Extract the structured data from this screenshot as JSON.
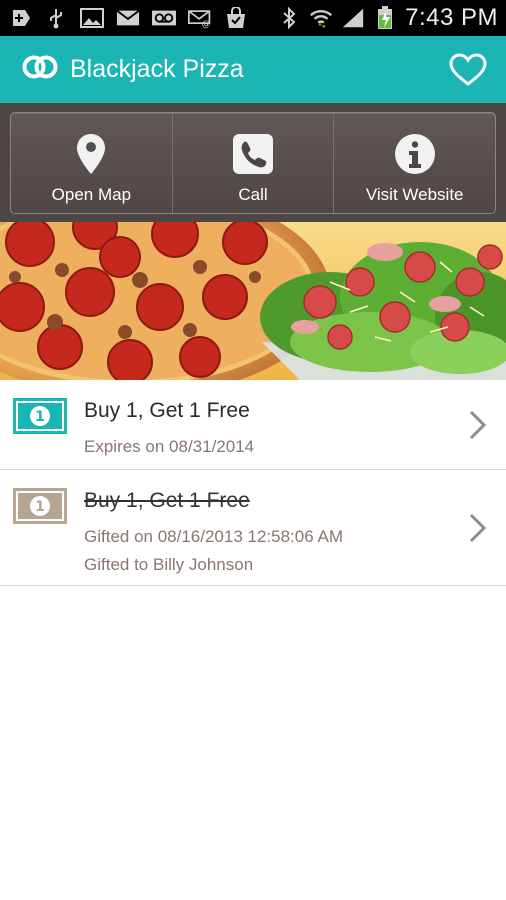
{
  "status_bar": {
    "time": "7:43 PM",
    "icons": [
      "add-icon",
      "usb-icon",
      "image-icon",
      "gmail-icon",
      "voicemail-icon",
      "missed-email-icon",
      "store-bag-icon",
      "bluetooth-icon",
      "wifi-icon",
      "signal-icon",
      "battery-charging-icon"
    ]
  },
  "header": {
    "title": "Blackjack Pizza",
    "logo": "rings-logo-icon",
    "favorite_icon": "heart-icon"
  },
  "actions": [
    {
      "label": "Open Map",
      "icon": "map-pin-icon"
    },
    {
      "label": "Call",
      "icon": "phone-icon"
    },
    {
      "label": "Visit Website",
      "icon": "info-icon"
    }
  ],
  "colors": {
    "accent": "#1bb5b5",
    "action_bar": "#4e4644",
    "sub_text": "#8a7670",
    "badge_active": "#1bb5b5",
    "badge_used": "#b5a592"
  },
  "deals": [
    {
      "title": "Buy 1, Get 1 Free",
      "line1": "Expires on 08/31/2014",
      "badge": "dollar-bill-icon",
      "status": "active"
    },
    {
      "title": "Buy 1, Get 1 Free",
      "line1": "Gifted on 08/16/2013 12:58:06 AM",
      "line2": "Gifted to Billy Johnson",
      "badge": "dollar-bill-icon",
      "status": "gifted"
    }
  ]
}
